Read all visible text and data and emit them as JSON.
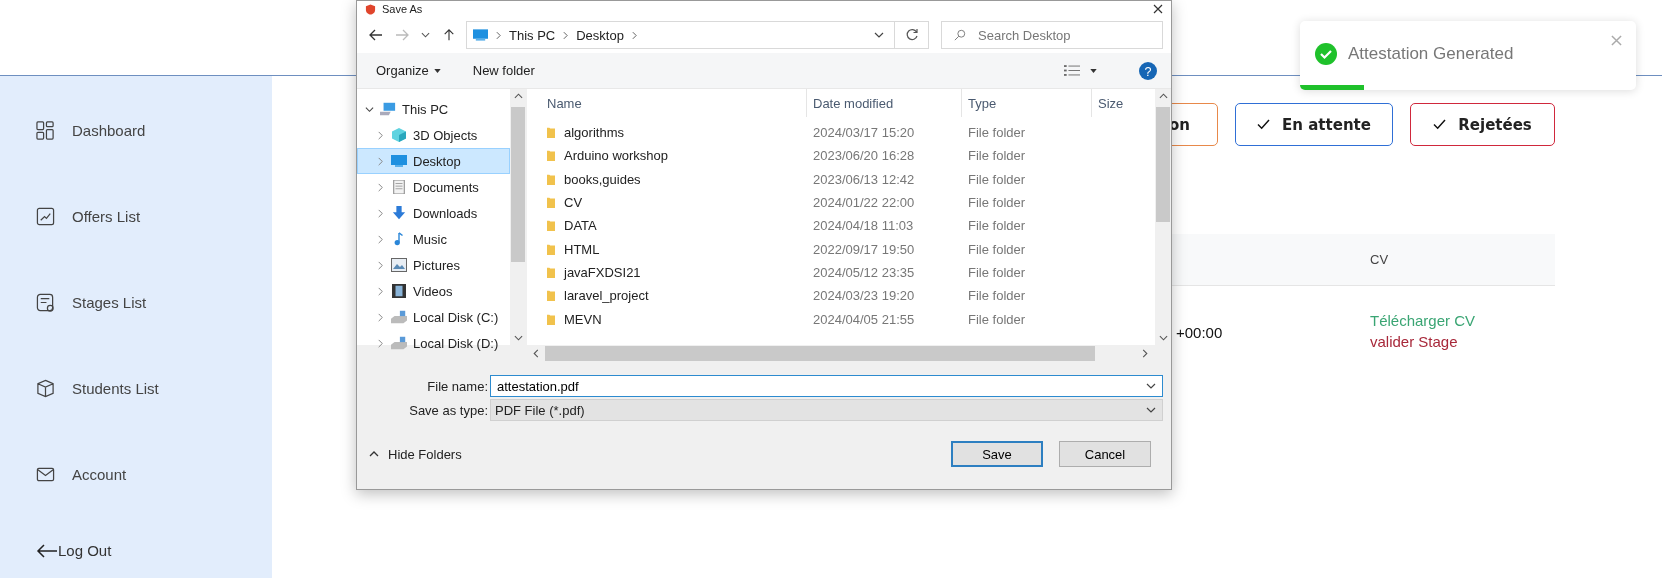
{
  "sidebar": {
    "items": [
      {
        "label": "Dashboard",
        "kind": "grid"
      },
      {
        "label": "Offers List",
        "kind": "chart"
      },
      {
        "label": "Stages List",
        "kind": "doc"
      },
      {
        "label": "Students List",
        "kind": "box"
      },
      {
        "label": "Account",
        "kind": "mail"
      }
    ],
    "logout": "Log Out"
  },
  "partial_filter": {
    "label": "on",
    "color": "#e8894a"
  },
  "filters": [
    {
      "label": "En attente",
      "color": "#2f6fd6",
      "checked": true
    },
    {
      "label": "Rejetées",
      "color": "#d0283c",
      "checked": true
    }
  ],
  "table": {
    "columns": [
      "CV"
    ],
    "rows": [
      {
        "column_1": "+00:00",
        "links": [
          {
            "label": "Télécharger CV",
            "kind": "download"
          },
          {
            "label": "valider Stage",
            "kind": "validate"
          }
        ]
      }
    ]
  },
  "toast": {
    "message": "Attestation Generated",
    "level": 0.19
  },
  "dialog": {
    "title": "Save As",
    "path": [
      "This PC",
      "Desktop"
    ],
    "search_placeholder": "Search Desktop",
    "organize": "Organize",
    "new_folder": "New folder",
    "tree": [
      {
        "label": "This PC",
        "kind": "pc",
        "expanded": true,
        "selected": false,
        "children": [
          {
            "label": "3D Objects",
            "kind": "cube",
            "expanded": false,
            "selected": false
          },
          {
            "label": "Desktop",
            "kind": "desktop",
            "expanded": false,
            "selected": true
          },
          {
            "label": "Documents",
            "kind": "document",
            "expanded": false,
            "selected": false
          },
          {
            "label": "Downloads",
            "kind": "download",
            "expanded": false,
            "selected": false
          },
          {
            "label": "Music",
            "kind": "music",
            "expanded": false,
            "selected": false
          },
          {
            "label": "Pictures",
            "kind": "picture",
            "expanded": false,
            "selected": false
          },
          {
            "label": "Videos",
            "kind": "video",
            "expanded": false,
            "selected": false
          },
          {
            "label": "Local Disk (C:)",
            "kind": "disk",
            "expanded": false,
            "selected": false
          },
          {
            "label": "Local Disk (D:)",
            "kind": "disk",
            "expanded": false,
            "selected": false
          }
        ]
      }
    ],
    "columns": [
      "Name",
      "Date modified",
      "Type",
      "Size"
    ],
    "files": [
      {
        "name": "algorithms",
        "date": "2024/03/17 15:20",
        "type": "File folder"
      },
      {
        "name": "Arduino workshop",
        "date": "2023/06/20 16:28",
        "type": "File folder"
      },
      {
        "name": "books,guides",
        "date": "2023/06/13 12:42",
        "type": "File folder"
      },
      {
        "name": "CV",
        "date": "2024/01/22 22:00",
        "type": "File folder"
      },
      {
        "name": "DATA",
        "date": "2024/04/18 11:03",
        "type": "File folder"
      },
      {
        "name": "HTML",
        "date": "2022/09/17 19:50",
        "type": "File folder"
      },
      {
        "name": "javaFXDSI21",
        "date": "2024/05/12 23:35",
        "type": "File folder"
      },
      {
        "name": "laravel_project",
        "date": "2024/03/23 19:20",
        "type": "File folder"
      },
      {
        "name": "MEVN",
        "date": "2024/04/05 21:55",
        "type": "File folder"
      }
    ],
    "file_name_label": "File name:",
    "file_name": "attestation.pdf",
    "file_type_label": "Save as type:",
    "file_type": "PDF File (*.pdf)",
    "help": "?",
    "hide_folders": "Hide Folders",
    "save": "Save",
    "cancel": "Cancel"
  }
}
